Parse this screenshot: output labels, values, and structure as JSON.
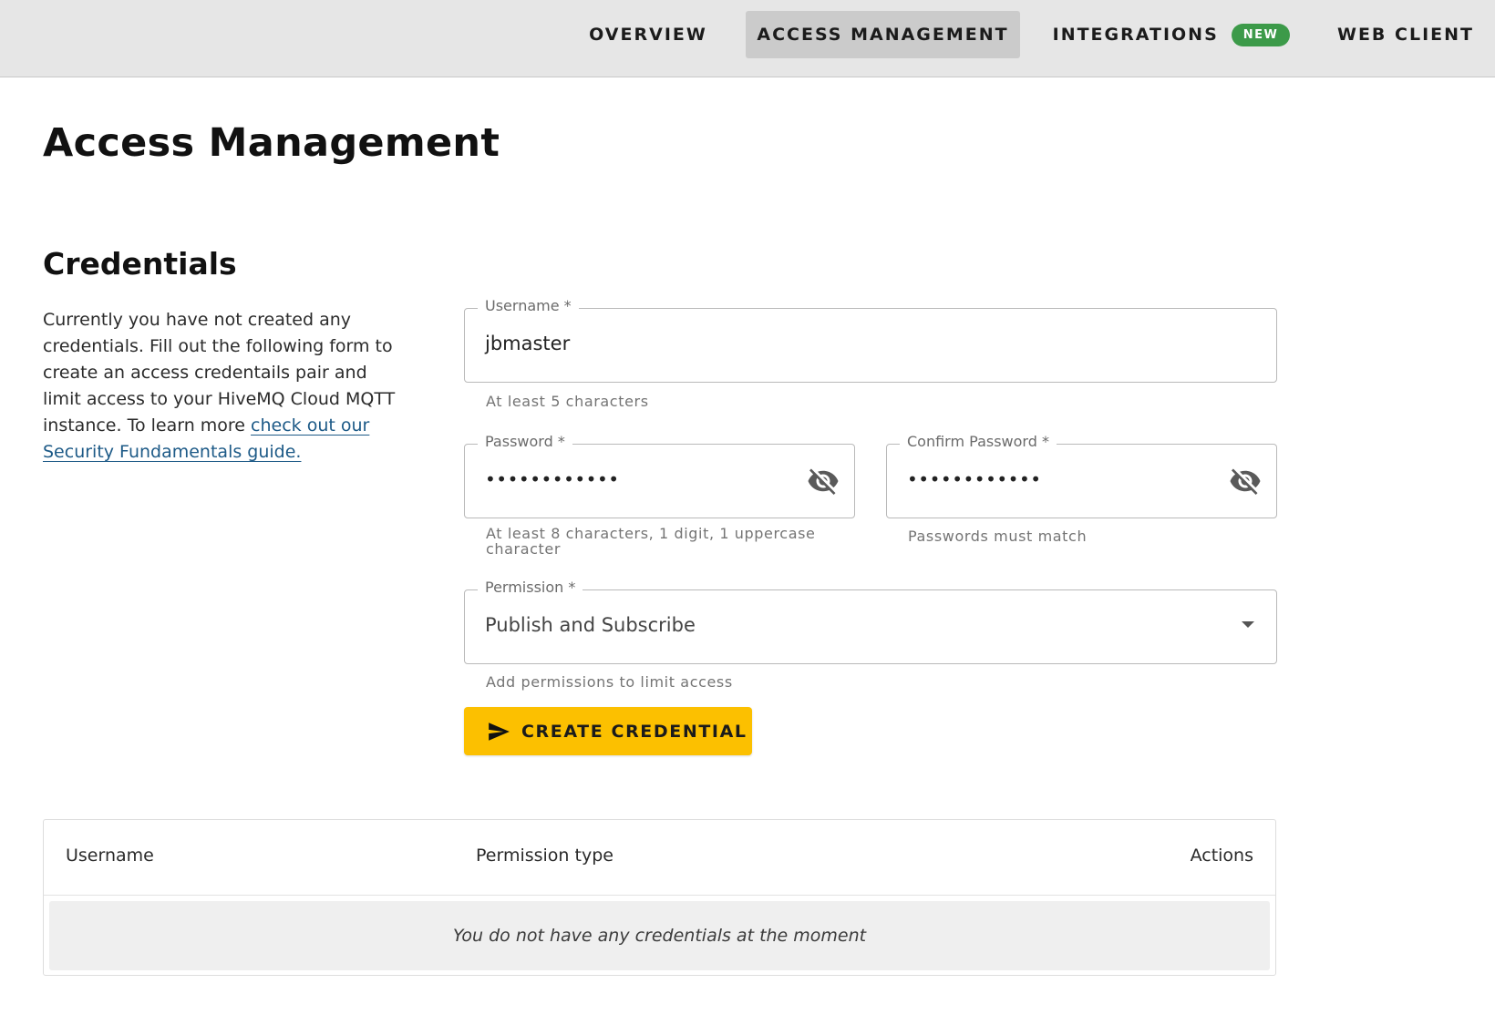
{
  "nav": {
    "items": [
      {
        "label": "OVERVIEW"
      },
      {
        "label": "ACCESS MANAGEMENT"
      },
      {
        "label": "INTEGRATIONS",
        "badge": "NEW"
      },
      {
        "label": "WEB CLIENT"
      }
    ],
    "active_index": 1,
    "badge_color": "#3c9a49"
  },
  "page": {
    "title": "Access Management"
  },
  "credentials": {
    "section_title": "Credentials",
    "intro_text": "Currently you have not created any credentials. Fill out the following form to create an access credentails pair and limit access to your HiveMQ Cloud MQTT instance. To learn more ",
    "intro_link": "check out our Security Fundamentals guide.",
    "form": {
      "username": {
        "label": "Username *",
        "value": "jbmaster",
        "helper": "At least 5 characters"
      },
      "password": {
        "label": "Password *",
        "value": "••••••••••••",
        "helper": "At least 8 characters, 1 digit, 1 uppercase character",
        "icon": "visibility-off-icon"
      },
      "confirm_password": {
        "label": "Confirm Password *",
        "value": "••••••••••••",
        "helper": "Passwords must match",
        "icon": "visibility-off-icon"
      },
      "permission": {
        "label": "Permission *",
        "value": "Publish and Subscribe",
        "helper": "Add permissions to limit access"
      },
      "create_button": {
        "label": "CREATE CREDENTIAL",
        "icon": "send-icon",
        "color": "#fcc000"
      }
    },
    "table": {
      "headers": [
        "Username",
        "Permission type",
        "Actions"
      ],
      "empty_message": "You do not have any credentials at the moment"
    }
  }
}
